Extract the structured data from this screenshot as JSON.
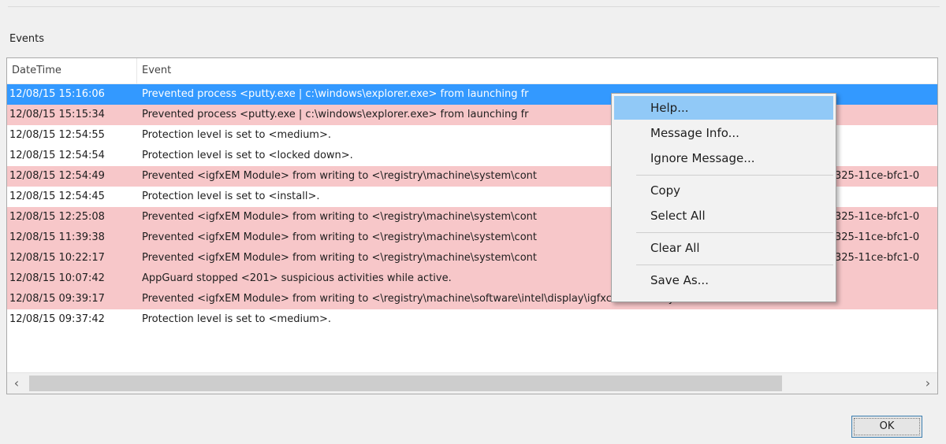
{
  "group": {
    "label": "Events"
  },
  "table": {
    "columns": [
      "DateTime",
      "Event"
    ],
    "rows": [
      {
        "datetime": "12/08/15 15:16:06",
        "event": "Prevented process <putty.exe | c:\\windows\\explorer.exe> from launching fr",
        "state": "selected"
      },
      {
        "datetime": "12/08/15 15:15:34",
        "event": "Prevented process <putty.exe | c:\\windows\\explorer.exe> from launching fr",
        "state": "warn"
      },
      {
        "datetime": "12/08/15 12:54:55",
        "event": "Protection level is set to <medium>.",
        "state": "normal"
      },
      {
        "datetime": "12/08/15 12:54:54",
        "event": "Protection level is set to <locked down>.",
        "state": "normal"
      },
      {
        "datetime": "12/08/15 12:54:49",
        "event": "Prevented <igfxEM Module> from writing to <\\registry\\machine\\system\\cont",
        "tail": "325-11ce-bfc1-0",
        "state": "warn"
      },
      {
        "datetime": "12/08/15 12:54:45",
        "event": "Protection level is set to <install>.",
        "state": "normal"
      },
      {
        "datetime": "12/08/15 12:25:08",
        "event": "Prevented <igfxEM Module> from writing to <\\registry\\machine\\system\\cont",
        "tail": "325-11ce-bfc1-0",
        "state": "warn"
      },
      {
        "datetime": "12/08/15 11:39:38",
        "event": "Prevented <igfxEM Module> from writing to <\\registry\\machine\\system\\cont",
        "tail": "325-11ce-bfc1-0",
        "state": "warn"
      },
      {
        "datetime": "12/08/15 10:22:17",
        "event": "Prevented <igfxEM Module> from writing to <\\registry\\machine\\system\\cont",
        "tail": "325-11ce-bfc1-0",
        "state": "warn"
      },
      {
        "datetime": "12/08/15 10:07:42",
        "event": "AppGuard stopped <201> suspicious activities while active.",
        "state": "warn"
      },
      {
        "datetime": "12/08/15 09:39:17",
        "event": "Prevented <igfxEM Module> from writing to <\\registry\\machine\\software\\intel\\display\\igfxcui\\mediakeys>.",
        "state": "warn"
      },
      {
        "datetime": "12/08/15 09:37:42",
        "event": "Protection level is set to <medium>.",
        "state": "normal"
      }
    ]
  },
  "scrollbar": {
    "left_arrow": "‹",
    "right_arrow": "›",
    "thumb_fraction": 0.85
  },
  "context_menu": {
    "items": [
      {
        "label": "Help...",
        "hover": true
      },
      {
        "label": "Message Info..."
      },
      {
        "label": "Ignore Message..."
      },
      {
        "separator": true
      },
      {
        "label": "Copy"
      },
      {
        "label": "Select All"
      },
      {
        "separator": true
      },
      {
        "label": "Clear All"
      },
      {
        "separator": true
      },
      {
        "label": "Save As..."
      }
    ]
  },
  "ok_button": {
    "label": "OK"
  },
  "colors": {
    "selection": "#3399ff",
    "warning_row": "#f7c7c9",
    "menu_hover": "#91c9f7"
  }
}
